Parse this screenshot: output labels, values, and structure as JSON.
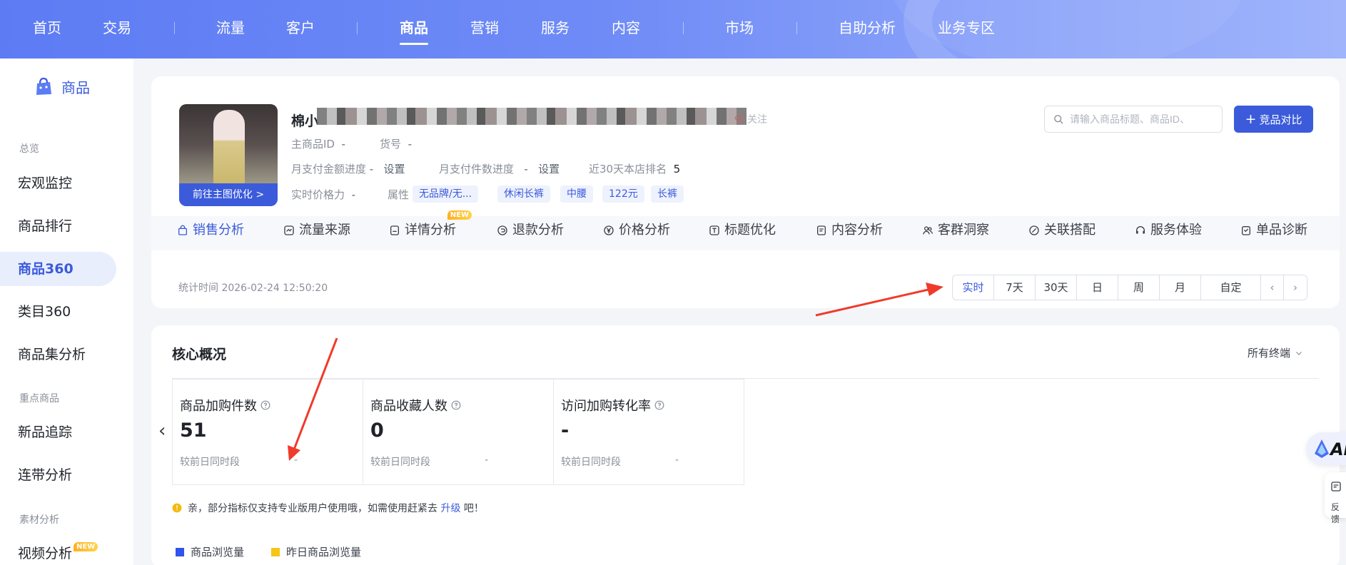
{
  "nav": {
    "items": [
      "首页",
      "交易",
      "流量",
      "客户",
      "商品",
      "营销",
      "服务",
      "内容",
      "市场",
      "自助分析",
      "业务专区"
    ],
    "active": "商品"
  },
  "sidebar": {
    "logo_label": "商品",
    "groups": [
      "总览",
      "重点商品",
      "素材分析"
    ],
    "items": [
      "宏观监控",
      "商品排行",
      "商品360",
      "类目360",
      "商品集分析",
      "新品追踪",
      "连带分析",
      "视频分析"
    ],
    "active": "商品360",
    "new_badge": "NEW"
  },
  "product": {
    "title": "棉小",
    "follow_label": "关注",
    "image_button": "前往主图优化 >",
    "main_id_label": "主商品ID",
    "main_id_value": "-",
    "sku_label": "货号",
    "sku_value": "-",
    "pay_amount_label": "月支付金额进度",
    "pay_amount_value": "-",
    "pay_amount_action": "设置",
    "pay_count_label": "月支付件数进度",
    "pay_count_value": "-",
    "pay_count_action": "设置",
    "rank_label": "近30天本店排名",
    "rank_value": "5",
    "price_power_label": "实时价格力",
    "price_power_value": "-",
    "attr_label": "属性",
    "tags": [
      "无品牌/无...",
      "休闲长裤",
      "中腰",
      "122元",
      "长裤"
    ]
  },
  "search": {
    "placeholder": "请输入商品标题、商品ID、"
  },
  "compare_button": "竞品对比",
  "tabs": [
    "销售分析",
    "流量来源",
    "详情分析",
    "退款分析",
    "价格分析",
    "标题优化",
    "内容分析",
    "客群洞察",
    "关联搭配",
    "服务体验",
    "单品诊断"
  ],
  "active_tab": "销售分析",
  "tab_new_badge": "NEW",
  "stat_time": "统计时间 2026-02-24 12:50:20",
  "ranges": [
    "实时",
    "7天",
    "30天",
    "日",
    "周",
    "月",
    "自定"
  ],
  "active_range": "实时",
  "core": {
    "title": "核心概况",
    "terminal": "所有终端",
    "metrics": [
      {
        "label": "商品加购件数",
        "value": "51",
        "compare_label": "较前日同时段",
        "compare_value": "-"
      },
      {
        "label": "商品收藏人数",
        "value": "0",
        "compare_label": "较前日同时段",
        "compare_value": "-"
      },
      {
        "label": "访问加购转化率",
        "value": "-",
        "compare_label": "较前日同时段",
        "compare_value": "-"
      }
    ],
    "notice_prefix": "亲，部分指标仅支持专业版用户使用哦，如需使用赶紧去",
    "notice_link": "升级",
    "notice_suffix": "吧！",
    "legend": [
      {
        "name": "商品浏览量",
        "color": "#2f54eb"
      },
      {
        "name": "昨日商品浏览量",
        "color": "#f5c518"
      }
    ]
  },
  "floats": {
    "ai_label": "AI",
    "feedback_label": "反馈"
  },
  "colors": {
    "primary": "#3b5bdb",
    "nav_gradient_start": "#5d7cf4",
    "annotation_arrow": "#f03a2a"
  }
}
